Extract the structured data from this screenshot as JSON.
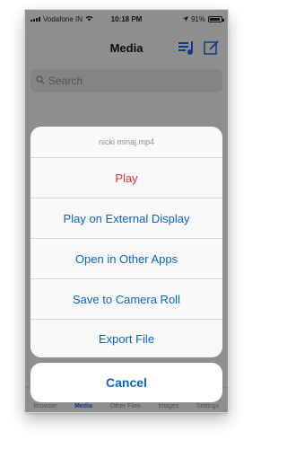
{
  "status": {
    "carrier": "Vodafone IN",
    "time": "10:18 PM",
    "battery": "91%"
  },
  "nav": {
    "title": "Media",
    "icons": [
      "playlist-icon",
      "compose-icon"
    ]
  },
  "search": {
    "placeholder": "Search"
  },
  "tabs": [
    {
      "label": "Browser"
    },
    {
      "label": "Media"
    },
    {
      "label": "Other Files"
    },
    {
      "label": "Images"
    },
    {
      "label": "Settings"
    }
  ],
  "action_sheet": {
    "title": "nicki minaj.mp4",
    "play": "Play",
    "external_display": "Play on External Display",
    "other_apps": "Open in Other Apps",
    "camera_roll": "Save to Camera Roll",
    "export": "Export File",
    "cancel": "Cancel"
  },
  "colors": {
    "accent": "#0a64c8",
    "destructive": "#e0342b"
  }
}
